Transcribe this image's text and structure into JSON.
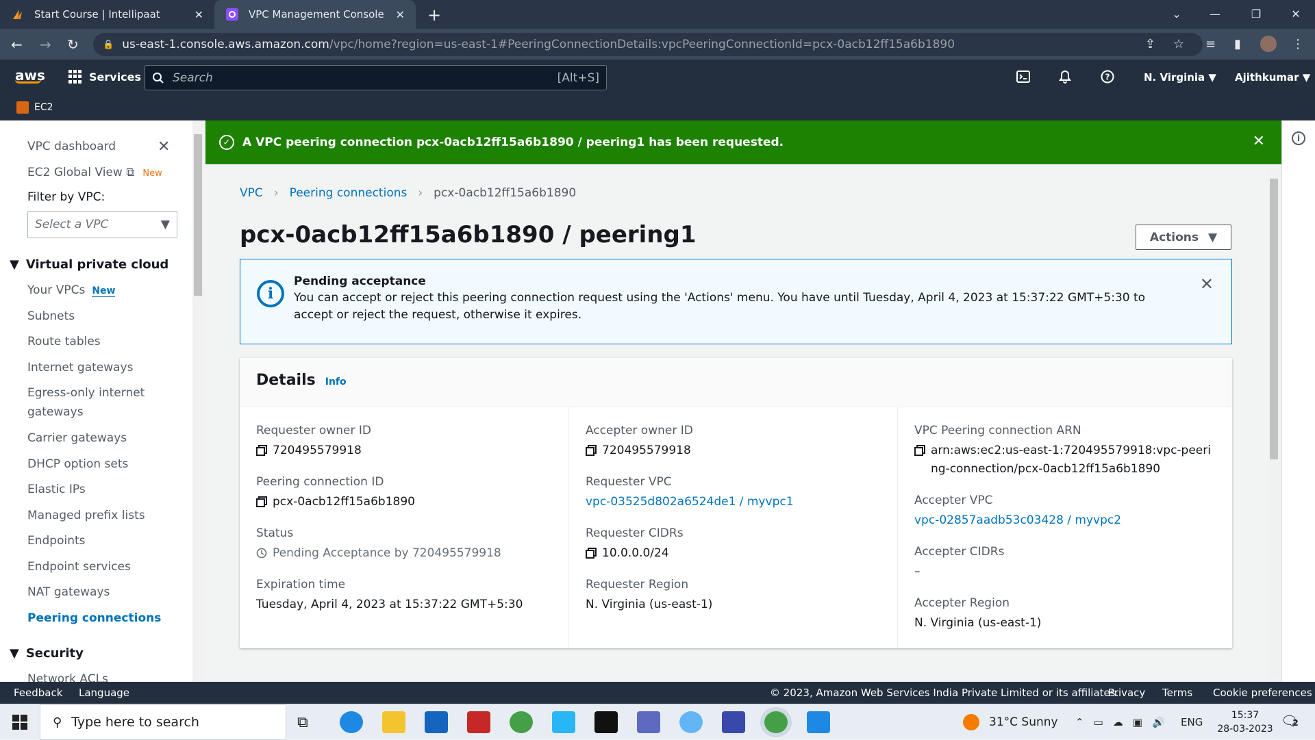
{
  "browser": {
    "tabs": [
      {
        "title": "Start Course | Intellipaat",
        "active": false
      },
      {
        "title": "VPC Management Console",
        "active": true
      }
    ],
    "url_host": "us-east-1.console.aws.amazon.com",
    "url_path": "/vpc/home?region=us-east-1#PeeringConnectionDetails:vpcPeeringConnectionId=pcx-0acb12ff15a6b1890"
  },
  "awsnav": {
    "logo": "aws",
    "services": "Services",
    "search_placeholder": "Search",
    "search_shortcut": "[Alt+S]",
    "region": "N. Virginia",
    "user": "Ajithkumar",
    "service_shortcut": "EC2"
  },
  "sidebar": {
    "top_items": [
      {
        "label": "VPC dashboard"
      },
      {
        "label": "EC2 Global View",
        "badge": "New"
      }
    ],
    "filter_label": "Filter by VPC:",
    "filter_placeholder": "Select a VPC",
    "section_vpc": "Virtual private cloud",
    "items": [
      {
        "label": "Your VPCs",
        "badge": "New"
      },
      {
        "label": "Subnets"
      },
      {
        "label": "Route tables"
      },
      {
        "label": "Internet gateways"
      },
      {
        "label": "Egress-only internet"
      },
      {
        "label": "gateways"
      },
      {
        "label": "Carrier gateways"
      },
      {
        "label": "DHCP option sets"
      },
      {
        "label": "Elastic IPs"
      },
      {
        "label": "Managed prefix lists"
      },
      {
        "label": "Endpoints"
      },
      {
        "label": "Endpoint services"
      },
      {
        "label": "NAT gateways"
      },
      {
        "label": "Peering connections",
        "active": true
      }
    ],
    "section_security": "Security",
    "partial_item": "Network ACLs"
  },
  "flash": {
    "message": "A VPC peering connection pcx-0acb12ff15a6b1890 / peering1 has been requested.",
    "color": "#1d8102"
  },
  "breadcrumb": [
    "VPC",
    "Peering connections",
    "pcx-0acb12ff15a6b1890"
  ],
  "page_title": "pcx-0acb12ff15a6b1890 / peering1",
  "actions_label": "Actions",
  "alert": {
    "heading": "Pending acceptance",
    "body": "You can accept or reject this peering connection request using the 'Actions' menu. You have until Tuesday, April 4, 2023 at 15:37:22 GMT+5:30 to accept or reject the request, otherwise it expires."
  },
  "details": {
    "title": "Details",
    "info": "Info",
    "col1": [
      {
        "key": "Requester owner ID",
        "value": "720495579918",
        "copy": true
      },
      {
        "key": "Peering connection ID",
        "value": "pcx-0acb12ff15a6b1890",
        "copy": true
      },
      {
        "key": "Status",
        "value": "Pending Acceptance by 720495579918",
        "status": true
      },
      {
        "key": "Expiration time",
        "value": "Tuesday, April 4, 2023 at 15:37:22 GMT+5:30"
      }
    ],
    "col2": [
      {
        "key": "Accepter owner ID",
        "value": "720495579918",
        "copy": true
      },
      {
        "key": "Requester VPC",
        "value": "vpc-03525d802a6524de1 / myvpc1",
        "link": true
      },
      {
        "key": "Requester CIDRs",
        "value": "10.0.0.0/24",
        "copy": true
      },
      {
        "key": "Requester Region",
        "value": "N. Virginia (us-east-1)"
      }
    ],
    "col3": [
      {
        "key": "VPC Peering connection ARN",
        "value": "arn:aws:ec2:us-east-1:720495579918:vpc-peering-connection/pcx-0acb12ff15a6b1890",
        "copy": true
      },
      {
        "key": "Accepter VPC",
        "value": "vpc-02857aadb53c03428 / myvpc2",
        "link": true
      },
      {
        "key": "Accepter CIDRs",
        "value": "–"
      },
      {
        "key": "Accepter Region",
        "value": "N. Virginia (us-east-1)"
      }
    ]
  },
  "footer": {
    "feedback": "Feedback",
    "language": "Language",
    "copyright": "© 2023, Amazon Web Services India Private Limited or its affiliates.",
    "privacy": "Privacy",
    "terms": "Terms",
    "cookies": "Cookie preferences"
  },
  "taskbar": {
    "search_placeholder": "Type here to search",
    "weather": "31°C  Sunny",
    "lang": "ENG",
    "time": "15:37",
    "date": "28-03-2023",
    "notif_count": "2"
  }
}
